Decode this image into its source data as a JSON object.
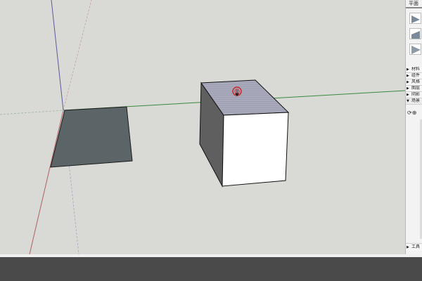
{
  "tray": {
    "title": "平面",
    "panels": [
      {
        "label": "材料",
        "state": "collapsed"
      },
      {
        "label": "组件",
        "state": "collapsed"
      },
      {
        "label": "风格",
        "state": "collapsed"
      },
      {
        "label": "图层",
        "state": "collapsed"
      },
      {
        "label": "阴影",
        "state": "collapsed"
      },
      {
        "label": "场景",
        "state": "expanded"
      }
    ],
    "scene_tools": [
      "refresh-icon",
      "add-scene-icon"
    ],
    "bottom_panel": {
      "label": "工具",
      "state": "collapsed"
    }
  },
  "colors": {
    "viewport_bg": "#d9d9d6",
    "selected_face": "#5b6568",
    "box_top": "#a2a3b6",
    "box_side": "#5f5f5f",
    "box_front": "#ffffff",
    "axis_green": "#3a8a3a",
    "axis_red": "#b06060",
    "axis_blue": "#5a5a9a",
    "cursor_red": "#cc2b2b",
    "taskbar": "#4a4a4a"
  },
  "viewport": {
    "icons": [
      "push-pull-cursor-icon"
    ]
  }
}
